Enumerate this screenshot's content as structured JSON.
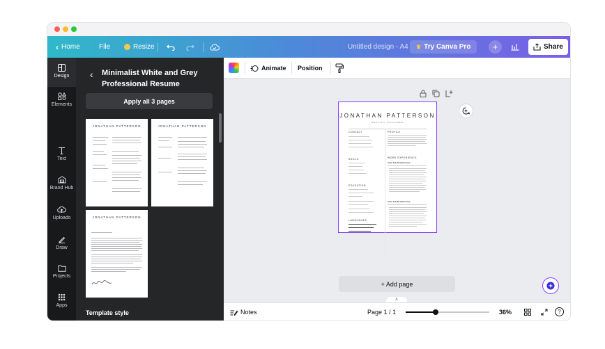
{
  "window": {
    "dots": [
      "#ff5f57",
      "#febc2e",
      "#28c840"
    ]
  },
  "topbar": {
    "home": "Home",
    "file": "File",
    "resize": "Resize",
    "design_title": "Untitled design - A4",
    "try_pro": "Try Canva Pro",
    "share": "Share"
  },
  "rail": {
    "items": [
      {
        "label": "Design",
        "icon": "layout-icon"
      },
      {
        "label": "Elements",
        "icon": "shapes-icon"
      },
      {
        "label": "Text",
        "icon": "text-icon"
      },
      {
        "label": "Brand Hub",
        "icon": "brand-icon"
      },
      {
        "label": "Uploads",
        "icon": "cloud-upload-icon"
      },
      {
        "label": "Draw",
        "icon": "pen-icon"
      },
      {
        "label": "Projects",
        "icon": "folder-icon"
      },
      {
        "label": "Apps",
        "icon": "grid-icon"
      }
    ]
  },
  "panel": {
    "title_line1": "Minimalist White and Grey",
    "title_line2": "Professional Resume",
    "apply_button": "Apply all 3 pages",
    "template_style": "Template style",
    "thumb_name": "JONATHAN PATTERSON"
  },
  "toolbar": {
    "animate": "Animate",
    "position": "Position"
  },
  "page": {
    "name": "JONATHAN PATTERSON",
    "role": "GRAPHIC DESIGNER",
    "contact": "CONTACT",
    "profile": "PROFILE",
    "skills": "SKILLS",
    "work": "WORK EXPERIENCE",
    "education": "EDUCATION",
    "languages": "LANGUAGES",
    "job1": "Your Job Position here",
    "job2": "Your Job Position here"
  },
  "canvas": {
    "add_page": "+ Add page"
  },
  "bottombar": {
    "notes": "Notes",
    "page_indicator": "Page 1 / 1",
    "zoom": "36%",
    "zoom_level": 0.36
  },
  "colors": {
    "accent": "#8b3dff",
    "topbar_start": "#2fb9c9",
    "topbar_end": "#7a5fe6",
    "pro_crown": "#f9c74f"
  }
}
